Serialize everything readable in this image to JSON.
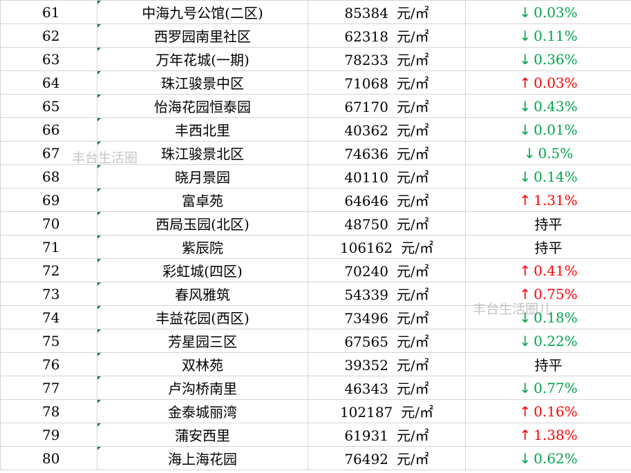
{
  "unit": "元/㎡",
  "colors": {
    "up": "#ff0000",
    "down": "#00a34a",
    "flat": "#000000",
    "grid": "#d4d4d4",
    "corner_marker": "#1e7b3e"
  },
  "icons": {
    "up": "arrow-up-icon",
    "down": "arrow-down-icon"
  },
  "watermarks": [
    "丰台生活圈",
    "丰台生活圈儿"
  ],
  "rows": [
    {
      "num": "61",
      "name": "中海九号公馆(二区)",
      "price": "85384",
      "dir": "down",
      "arrow": "↓",
      "change": "0.03%"
    },
    {
      "num": "62",
      "name": "西罗园南里社区",
      "price": "62318",
      "dir": "down",
      "arrow": "↓",
      "change": "0.11%"
    },
    {
      "num": "63",
      "name": "万年花城(一期)",
      "price": "78233",
      "dir": "down",
      "arrow": "↓",
      "change": "0.36%"
    },
    {
      "num": "64",
      "name": "珠江骏景中区",
      "price": "71068",
      "dir": "up",
      "arrow": "↑",
      "change": "0.03%"
    },
    {
      "num": "65",
      "name": "怡海花园恒泰园",
      "price": "67170",
      "dir": "down",
      "arrow": "↓",
      "change": "0.43%"
    },
    {
      "num": "66",
      "name": "丰西北里",
      "price": "40362",
      "dir": "down",
      "arrow": "↓",
      "change": "0.01%"
    },
    {
      "num": "67",
      "name": "珠江骏景北区",
      "price": "74636",
      "dir": "down",
      "arrow": "↓",
      "change": "0.5%"
    },
    {
      "num": "68",
      "name": "晓月景园",
      "price": "40110",
      "dir": "down",
      "arrow": "↓",
      "change": "0.14%"
    },
    {
      "num": "69",
      "name": "富卓苑",
      "price": "64646",
      "dir": "up",
      "arrow": "↑",
      "change": "1.31%"
    },
    {
      "num": "70",
      "name": "西局玉园(北区)",
      "price": "48750",
      "dir": "flat",
      "arrow": "",
      "change": "持平"
    },
    {
      "num": "71",
      "name": "紫辰院",
      "price": "106162",
      "dir": "flat",
      "arrow": "",
      "change": "持平"
    },
    {
      "num": "72",
      "name": "彩虹城(四区)",
      "price": "70240",
      "dir": "up",
      "arrow": "↑",
      "change": "0.41%"
    },
    {
      "num": "73",
      "name": "春风雅筑",
      "price": "54339",
      "dir": "up",
      "arrow": "↑",
      "change": "0.75%"
    },
    {
      "num": "74",
      "name": "丰益花园(西区)",
      "price": "73496",
      "dir": "down",
      "arrow": "↓",
      "change": "0.18%"
    },
    {
      "num": "75",
      "name": "芳星园三区",
      "price": "67565",
      "dir": "down",
      "arrow": "↓",
      "change": "0.22%"
    },
    {
      "num": "76",
      "name": "双林苑",
      "price": "39352",
      "dir": "flat",
      "arrow": "",
      "change": "持平"
    },
    {
      "num": "77",
      "name": "卢沟桥南里",
      "price": "46343",
      "dir": "down",
      "arrow": "↓",
      "change": "0.77%"
    },
    {
      "num": "78",
      "name": "金泰城丽湾",
      "price": "102187",
      "dir": "up",
      "arrow": "↑",
      "change": "0.16%"
    },
    {
      "num": "79",
      "name": "蒲安西里",
      "price": "61931",
      "dir": "up",
      "arrow": "↑",
      "change": "1.38%"
    },
    {
      "num": "80",
      "name": "海上海花园",
      "price": "76492",
      "dir": "down",
      "arrow": "↓",
      "change": "0.62%"
    }
  ]
}
